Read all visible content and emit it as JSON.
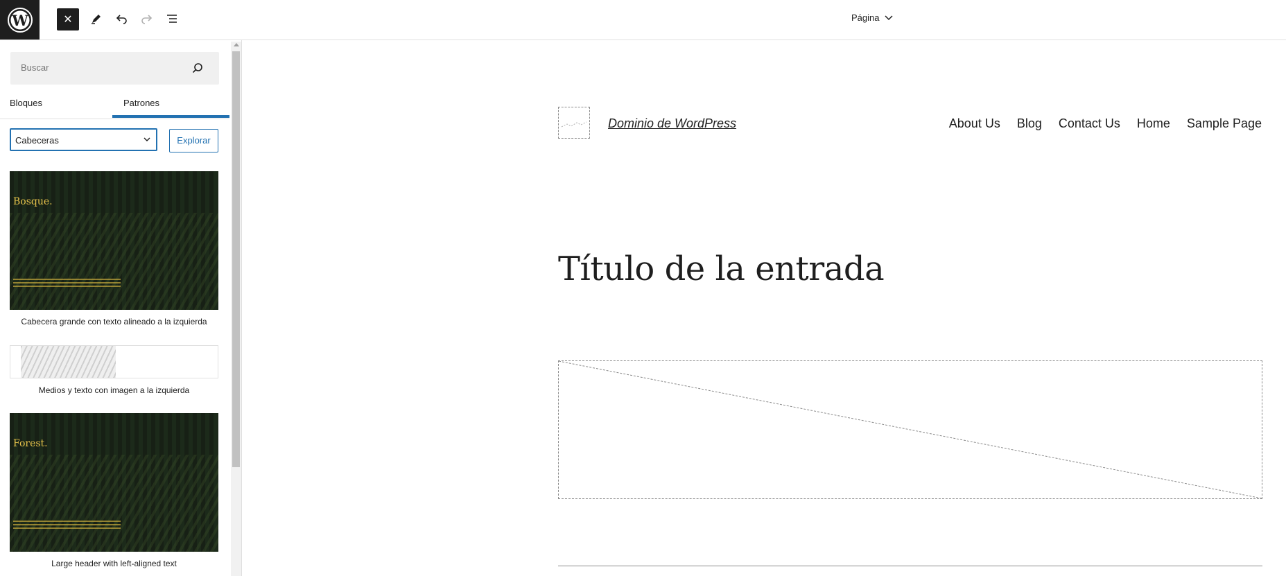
{
  "toolbar": {
    "close_label": "✕",
    "document_title": "Página"
  },
  "sidebar": {
    "search_placeholder": "Buscar",
    "tabs": [
      {
        "label": "Bloques"
      },
      {
        "label": "Patrones"
      }
    ],
    "category_select": "Cabeceras",
    "explore_label": "Explorar",
    "patterns": [
      {
        "heading": "Bosque.",
        "caption": "Cabecera grande con texto alineado a la izquierda"
      },
      {
        "caption": "Medios y texto con imagen a la izquierda"
      },
      {
        "heading": "Forest.",
        "caption": "Large header with left-aligned text"
      }
    ]
  },
  "canvas": {
    "site_title": "Dominio de WordPress",
    "nav": [
      "About Us",
      "Blog",
      "Contact Us",
      "Home",
      "Sample Page"
    ],
    "post_title": "Título de la entrada"
  },
  "colors": {
    "accent": "#2271b1",
    "dark": "#1e1e1e",
    "pattern_text": "#e6c24b"
  }
}
